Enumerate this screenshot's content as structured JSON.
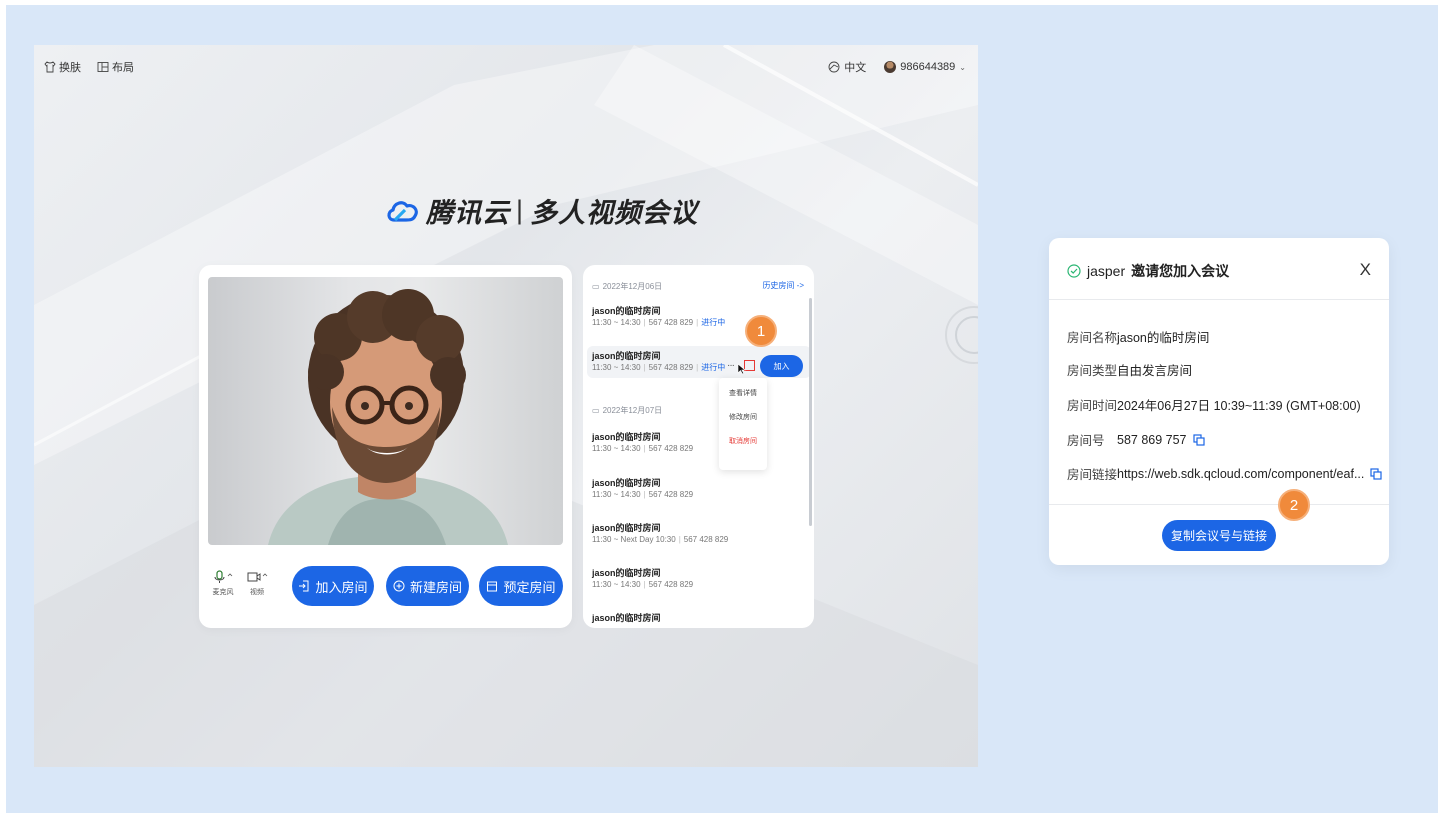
{
  "app": {
    "topbar": {
      "skin_label": "换肤",
      "layout_label": "布局",
      "language_label": "中文",
      "user_id": "986644389"
    },
    "brand": {
      "name": "腾讯云",
      "divider": "|",
      "product": "多人视频会议"
    },
    "controls": {
      "mic_label": "麦克风",
      "camera_label": "视频",
      "join_room": "加入房间",
      "create_room": "新建房间",
      "schedule_room": "预定房间"
    },
    "schedule": {
      "history_link": "历史房间 ->",
      "day1": "2022年12月06日",
      "day2": "2022年12月07日",
      "rooms": [
        {
          "title": "jason的临时房间",
          "time": "11:30 ~ 14:30",
          "id": "567 428 829",
          "status": "进行中"
        },
        {
          "title": "jason的临时房间",
          "time": "11:30 ~ 14:30",
          "id": "567 428 829",
          "status": "进行中"
        },
        {
          "title": "jason的临时房间",
          "time": "11:30 ~ 14:30",
          "id": "567 428 829",
          "status": ""
        },
        {
          "title": "jason的临时房间",
          "time": "11:30 ~ 14:30",
          "id": "567 428 829",
          "status": ""
        },
        {
          "title": "jason的临时房间",
          "time": "11:30 ~ Next Day 10:30",
          "id": "567 428 829",
          "status": ""
        },
        {
          "title": "jason的临时房间",
          "time": "11:30 ~ 14:30",
          "id": "567 428 829",
          "status": ""
        },
        {
          "title": "jason的临时房间",
          "time": "",
          "id": "",
          "status": ""
        }
      ],
      "join_button": "加入",
      "more_menu": [
        "查看详情",
        "修改房间",
        "取消房间"
      ]
    },
    "badge_1": "1"
  },
  "dialog": {
    "title_user": "jasper",
    "title_text": "邀请您加入会议",
    "close": "X",
    "fields": [
      {
        "label": "房间名称",
        "value": "jason的临时房间"
      },
      {
        "label": "房间类型",
        "value": "自由发言房间"
      },
      {
        "label": "房间时间",
        "value": "2024年06月27日 10:39~11:39 (GMT+08:00)"
      },
      {
        "label": "房间号",
        "value": "587 869 757"
      },
      {
        "label": "房间链接",
        "value": "https://web.sdk.qcloud.com/component/eaf..."
      }
    ],
    "copy_button": "复制会议号与链接",
    "badge_2": "2"
  },
  "colors": {
    "primary": "#1c66e5",
    "badge": "#f08a3b",
    "danger": "#e53935",
    "page_bg": "#d9e7f8"
  }
}
